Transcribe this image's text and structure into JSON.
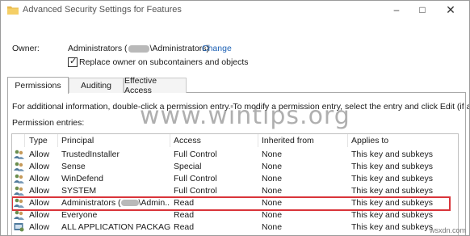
{
  "window": {
    "title": "Advanced Security Settings for Features",
    "controls": {
      "minimize": "–",
      "maximize": "□",
      "close": "✕"
    }
  },
  "owner": {
    "label": "Owner:",
    "value_prefix": "Administrators (",
    "value_suffix": "\\Administrators)",
    "change_link": "Change",
    "replace_label": "Replace owner on subcontainers and objects",
    "replace_checked": true
  },
  "tabs": [
    {
      "label": "Permissions",
      "active": true
    },
    {
      "label": "Auditing",
      "active": false
    },
    {
      "label": "Effective Access",
      "active": false
    }
  ],
  "permissions": {
    "info_text": "For additional information, double-click a permission entry. To modify a permission entry, select the entry and click Edit (if available).",
    "entries_label": "Permission entries:",
    "columns": [
      "Type",
      "Principal",
      "Access",
      "Inherited from",
      "Applies to"
    ],
    "rows": [
      {
        "type": "Allow",
        "principal": "TrustedInstaller",
        "access": "Full Control",
        "inherited": "None",
        "applies": "This key and subkeys"
      },
      {
        "type": "Allow",
        "principal": "Sense",
        "access": "Special",
        "inherited": "None",
        "applies": "This key and subkeys"
      },
      {
        "type": "Allow",
        "principal": "WinDefend",
        "access": "Full Control",
        "inherited": "None",
        "applies": "This key and subkeys"
      },
      {
        "type": "Allow",
        "principal": "SYSTEM",
        "access": "Full Control",
        "inherited": "None",
        "applies": "This key and subkeys"
      },
      {
        "type": "Allow",
        "principal": "Administrators (",
        "principal_suffix": "\\Admin...",
        "access": "Read",
        "inherited": "None",
        "applies": "This key and subkeys",
        "highlighted": true
      },
      {
        "type": "Allow",
        "principal": "Everyone",
        "access": "Read",
        "inherited": "None",
        "applies": "This key and subkeys"
      },
      {
        "type": "Allow",
        "principal": "ALL APPLICATION PACKAGES",
        "access": "Read",
        "inherited": "None",
        "applies": "This key and subkeys"
      }
    ]
  },
  "watermark": "www.wintips.org",
  "corner_watermark": "wsxdn.com",
  "colors": {
    "link": "#1a5fb4",
    "highlight_border": "#d9343a"
  }
}
